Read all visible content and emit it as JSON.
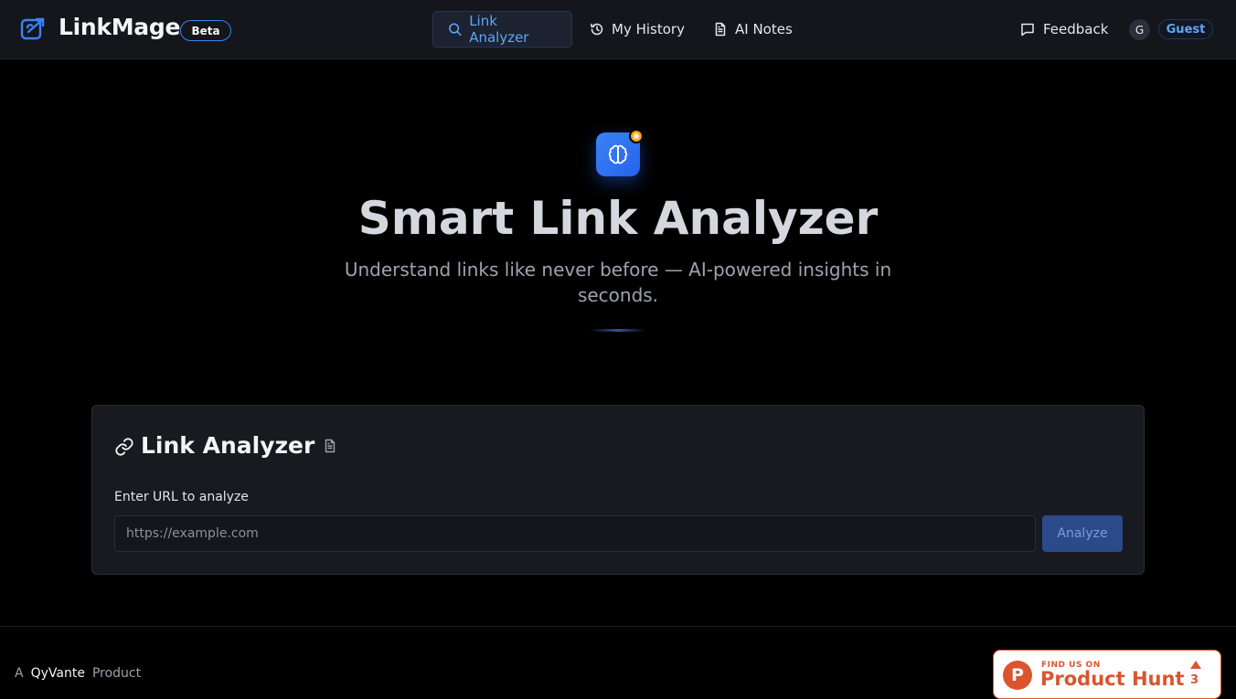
{
  "header": {
    "app_name": "LinkMage",
    "beta_label": "Beta",
    "nav": [
      {
        "label": "Link Analyzer",
        "icon": "search-icon",
        "active": true
      },
      {
        "label": "My History",
        "icon": "history-icon",
        "active": false
      },
      {
        "label": "AI Notes",
        "icon": "document-icon",
        "active": false
      }
    ],
    "feedback_label": "Feedback",
    "avatar_initial": "G",
    "user_label": "Guest"
  },
  "hero": {
    "icon": "brain-icon",
    "badge_icon": "sparkle-icon",
    "title": "Smart Link Analyzer",
    "subtitle": "Understand links like never before — AI-powered insights in seconds."
  },
  "analyzer": {
    "title": "Link Analyzer",
    "title_icon": "link-icon",
    "notes_icon": "document-icon",
    "input_label": "Enter URL to analyze",
    "input_value": "",
    "input_placeholder": "https://example.com",
    "analyze_label": "Analyze"
  },
  "footer": {
    "prefix": "A",
    "brand": "QyVante",
    "suffix": "Product",
    "product_hunt": {
      "logo_letter": "P",
      "small_text": "FIND US ON",
      "big_text": "Product Hunt",
      "upvotes": "3"
    }
  },
  "colors": {
    "accent": "#3b82f6",
    "product_hunt": "#da552f",
    "badge_orange": "#f59e0b"
  }
}
